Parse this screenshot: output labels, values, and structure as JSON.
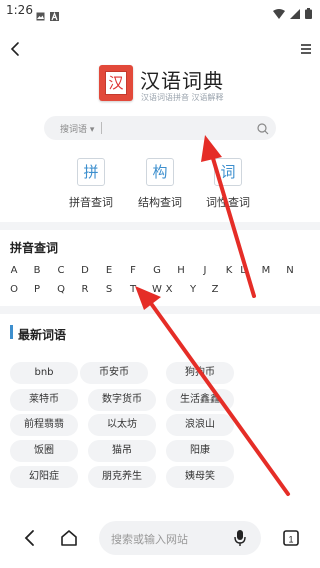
{
  "status": {
    "time": "1:26",
    "icons": [
      "image-icon",
      "a-icon",
      "wifi-icon",
      "signal-icon",
      "battery-icon"
    ]
  },
  "nav": {
    "back_icon": "chevron-left-icon",
    "menu_icon": "hamburger-icon"
  },
  "app": {
    "logo_char": "汉",
    "title": "汉语词典",
    "subtitle": "汉语词语拼音 汉语解释"
  },
  "search": {
    "type_label": "搜词语",
    "placeholder": ""
  },
  "methods": [
    {
      "icon_char": "拼",
      "label": "拼音查词"
    },
    {
      "icon_char": "构",
      "label": "结构查词"
    },
    {
      "icon_char": "词",
      "label": "词性查词"
    }
  ],
  "pinyin": {
    "title": "拼音查词",
    "row1": [
      "A",
      "B",
      "C",
      "D",
      "E",
      "F",
      "G",
      "H",
      "J",
      "K",
      "L",
      "M",
      "N"
    ],
    "row2": [
      "O",
      "P",
      "Q",
      "R",
      "S",
      "T",
      "W",
      "X",
      "Y",
      "Z"
    ]
  },
  "latest": {
    "title": "最新词语",
    "words": [
      "bnb",
      "币安币",
      "狗狗币",
      "莱特币",
      "数字货币",
      "生活鑫鑫",
      "前程翡翡",
      "以太坊",
      "浪浪山",
      "饭圈",
      "猫吊",
      "阳康",
      "幻阳症",
      "朋克养生",
      "姨母笑"
    ]
  },
  "bottom": {
    "search_placeholder": "搜索或输入网站"
  },
  "colors": {
    "accent": "#3d8fce",
    "logo": "#e2493a",
    "arrow": "#e52d27"
  }
}
